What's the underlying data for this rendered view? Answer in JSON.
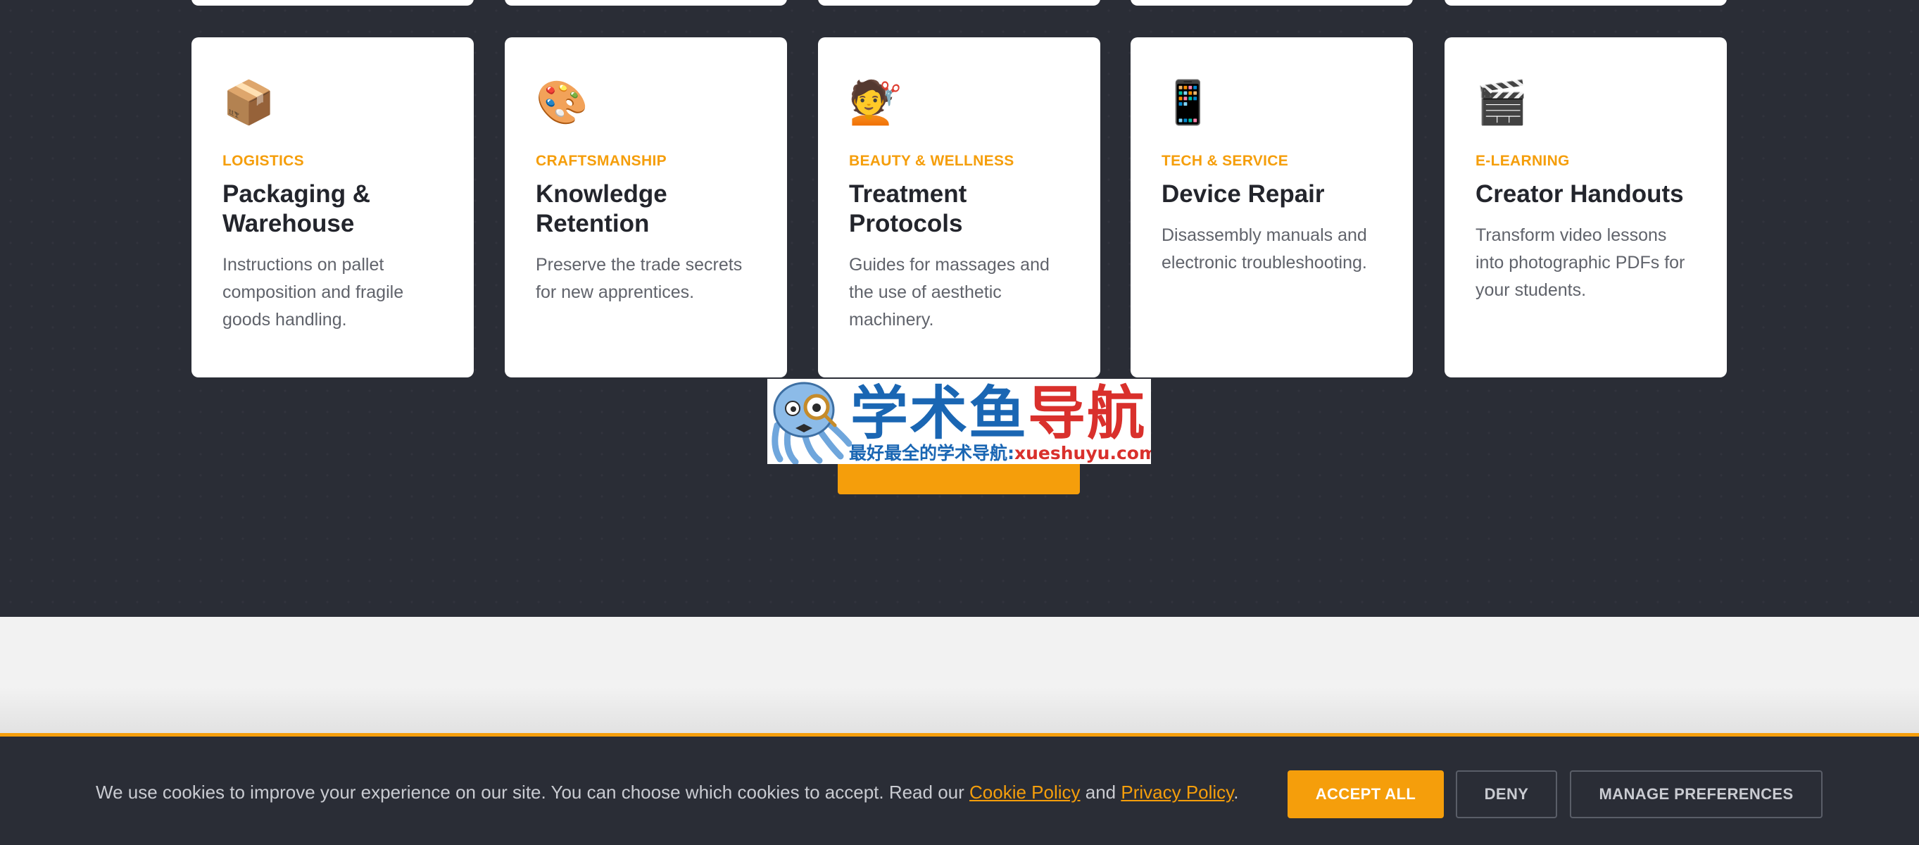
{
  "cards": [
    {
      "icon": "package-icon",
      "emoji": "📦",
      "category": "LOGISTICS",
      "title": "Packaging & Warehouse",
      "description": "Instructions on pallet composition and fragile goods handling."
    },
    {
      "icon": "palette-icon",
      "emoji": "🎨",
      "category": "CRAFTSMANSHIP",
      "title": "Knowledge Retention",
      "description": "Preserve the trade secrets for new apprentices."
    },
    {
      "icon": "haircut-icon",
      "emoji": "💇",
      "category": "BEAUTY & WELLNESS",
      "title": "Treatment Protocols",
      "description": "Guides for massages and the use of aesthetic machinery."
    },
    {
      "icon": "mobile-phone-icon",
      "emoji": "📱",
      "category": "TECH & SERVICE",
      "title": "Device Repair",
      "description": "Disassembly manuals and electronic troubleshooting."
    },
    {
      "icon": "clapper-board-icon",
      "emoji": "🎬",
      "category": "E-LEARNING",
      "title": "Creator Handouts",
      "description": "Transform video lessons into photographic PDFs for your students."
    }
  ],
  "watermark": {
    "title_blue": "学术鱼",
    "title_red": "导航",
    "subtitle_blue": "最好最全的学术导航:",
    "subtitle_red": "xueshuyu.com"
  },
  "cookie": {
    "text_before": "We use cookies to improve your experience on our site. You can choose which cookies to accept. Read our ",
    "cookie_policy_link": "Cookie Policy",
    "text_and": " and ",
    "privacy_policy_link": "Privacy Policy",
    "text_end": ".",
    "accept_label": "ACCEPT ALL",
    "deny_label": "DENY",
    "manage_label": "MANAGE PREFERENCES"
  },
  "colors": {
    "accent": "#f59e0b",
    "dark_background": "#2a2d36",
    "card_background": "#ffffff",
    "light_background": "#f2f2f2"
  }
}
